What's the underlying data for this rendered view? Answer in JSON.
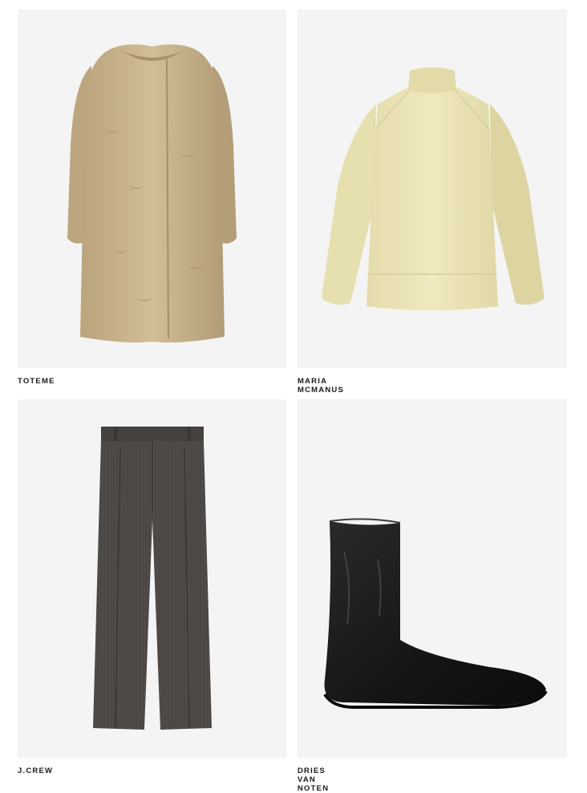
{
  "products": [
    {
      "brand": "TOTEME",
      "item": "shearling coat",
      "color": "#c9b48c"
    },
    {
      "brand": "MARIA MCMANUS",
      "item": "turtleneck sweater",
      "color": "#ebe4b4"
    },
    {
      "brand": "J.CREW",
      "item": "wide-leg trousers",
      "color": "#4b4846"
    },
    {
      "brand": "DRIES VAN NOTEN",
      "item": "leather ankle boot",
      "color": "#1c1c1c"
    }
  ]
}
